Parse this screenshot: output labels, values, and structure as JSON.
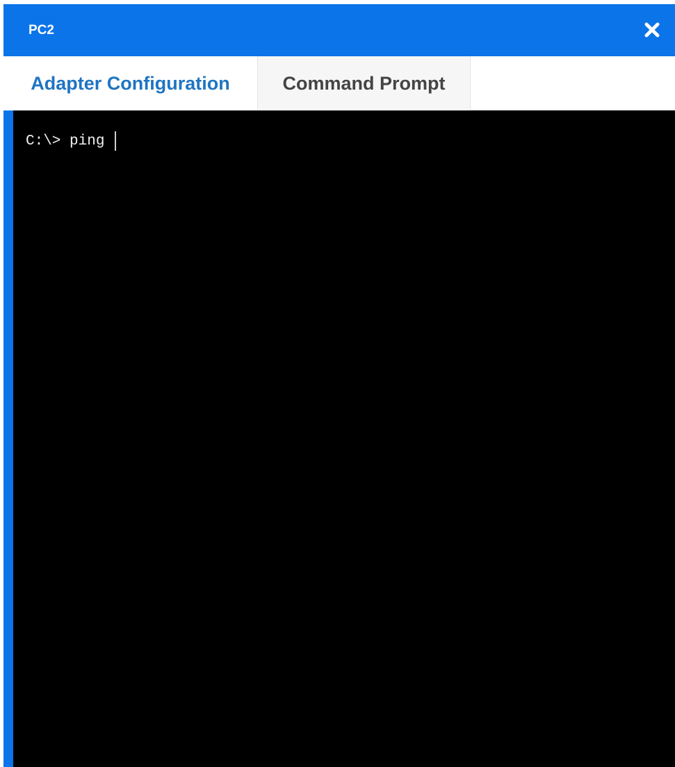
{
  "window": {
    "title": "PC2",
    "close_icon": "close-icon"
  },
  "tabs": [
    {
      "label": "Adapter Configuration",
      "active": false
    },
    {
      "label": "Command Prompt",
      "active": true
    }
  ],
  "terminal": {
    "prompt": "C:\\>",
    "command": "ping "
  },
  "colors": {
    "titlebar": "#0b74e8",
    "tab_link": "#1f74c2",
    "terminal_bg": "#000000",
    "terminal_text": "#f2f2f2"
  }
}
